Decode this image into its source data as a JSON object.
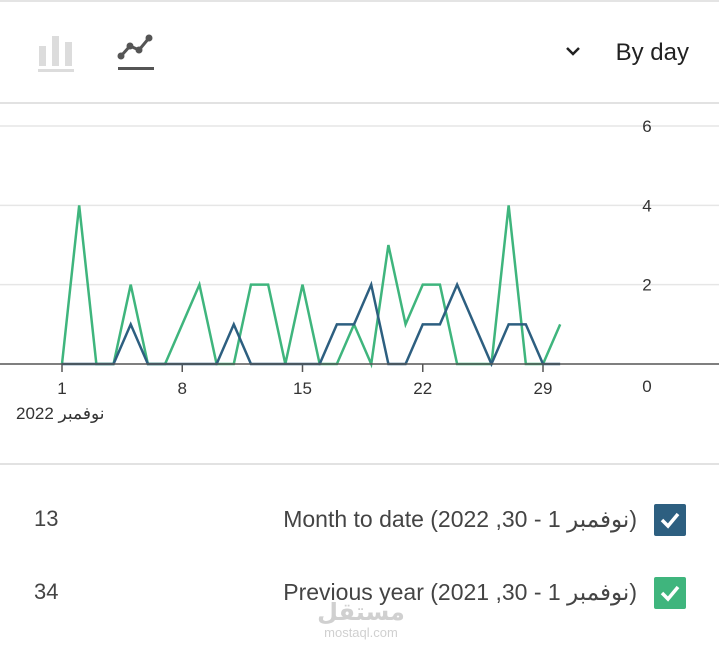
{
  "toolbar": {
    "bar_icon": "bar-chart-icon",
    "line_icon": "line-chart-icon",
    "range_label": "By day",
    "chevron_icon": "chevron-down-icon"
  },
  "chart_data": {
    "type": "line",
    "x_label": "نوفمبر 2022",
    "x_ticks": [
      1,
      8,
      15,
      22,
      29
    ],
    "y_ticks": [
      0,
      2,
      4,
      6
    ],
    "ylim": [
      0,
      6
    ],
    "xlim": [
      1,
      30
    ],
    "y_axis_side": "right",
    "grid": true,
    "x": [
      1,
      2,
      3,
      4,
      5,
      6,
      7,
      8,
      9,
      10,
      11,
      12,
      13,
      14,
      15,
      16,
      17,
      18,
      19,
      20,
      21,
      22,
      23,
      24,
      25,
      26,
      27,
      28,
      29,
      30
    ],
    "series": [
      {
        "color": "#3fb57d",
        "values": [
          0,
          4,
          0,
          0,
          2,
          0,
          0,
          1,
          2,
          0,
          0,
          2,
          2,
          0,
          2,
          0,
          0,
          1,
          0,
          3,
          1,
          2,
          2,
          0,
          0,
          0,
          4,
          0,
          0,
          1
        ]
      },
      {
        "color": "#2d5f80",
        "values": [
          0,
          0,
          0,
          0,
          1,
          0,
          0,
          0,
          0,
          0,
          1,
          0,
          0,
          0,
          0,
          0,
          1,
          1,
          2,
          0,
          0,
          1,
          1,
          2,
          1,
          0,
          1,
          1,
          0,
          0
        ]
      }
    ]
  },
  "legend": [
    {
      "label": "Month to date (نوفمبر 1 - 30, 2022)",
      "value": "13",
      "color": "#2d5f80",
      "checked": true,
      "icon": "check-icon"
    },
    {
      "label": "Previous year (نوفمبر 1 - 30, 2021)",
      "value": "34",
      "color": "#3fb57d",
      "checked": true,
      "icon": "check-icon"
    }
  ],
  "watermark": {
    "top": "مستقل",
    "bottom": "mostaql.com"
  }
}
